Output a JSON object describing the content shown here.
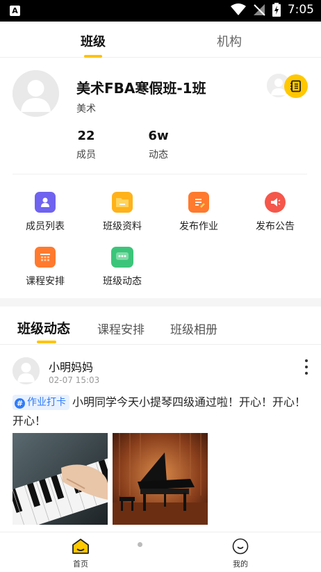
{
  "statusbar": {
    "time": "7:05",
    "app_badge": "A"
  },
  "top_tabs": [
    {
      "label": "班级",
      "active": true
    },
    {
      "label": "机构",
      "active": false
    }
  ],
  "class": {
    "name": "美术FBA寒假班-1班",
    "subject": "美术",
    "stats": [
      {
        "value": "22",
        "label": "成员"
      },
      {
        "value": "6w",
        "label": "动态"
      }
    ]
  },
  "menu": [
    {
      "label": "成员列表",
      "icon": "member-list-icon",
      "color": "#6F63F0"
    },
    {
      "label": "班级资料",
      "icon": "class-folder-icon",
      "color": "#FFB21A"
    },
    {
      "label": "发布作业",
      "icon": "publish-homework-icon",
      "color": "#FF7A2E"
    },
    {
      "label": "发布公告",
      "icon": "publish-announcement-icon",
      "color": "#F5574A"
    },
    {
      "label": "课程安排",
      "icon": "course-schedule-icon",
      "color": "#FF7A2E"
    },
    {
      "label": "班级动态",
      "icon": "class-feed-icon",
      "color": "#3CC57A"
    }
  ],
  "sub_tabs": [
    {
      "label": "班级动态",
      "active": true
    },
    {
      "label": "课程安排",
      "active": false
    },
    {
      "label": "班级相册",
      "active": false
    }
  ],
  "post": {
    "author": "小明妈妈",
    "time": "02-07 15:03",
    "tag": "作业打卡",
    "text": "小明同学今天小提琴四级通过啦！开心！开心！开心！"
  },
  "bottom_nav": [
    {
      "label": "首页",
      "icon": "home-icon",
      "active": true
    },
    {
      "label": "我的",
      "icon": "profile-face-icon",
      "active": false
    }
  ],
  "colors": {
    "accent": "#FFC300",
    "tag_blue": "#2F7BF5"
  }
}
